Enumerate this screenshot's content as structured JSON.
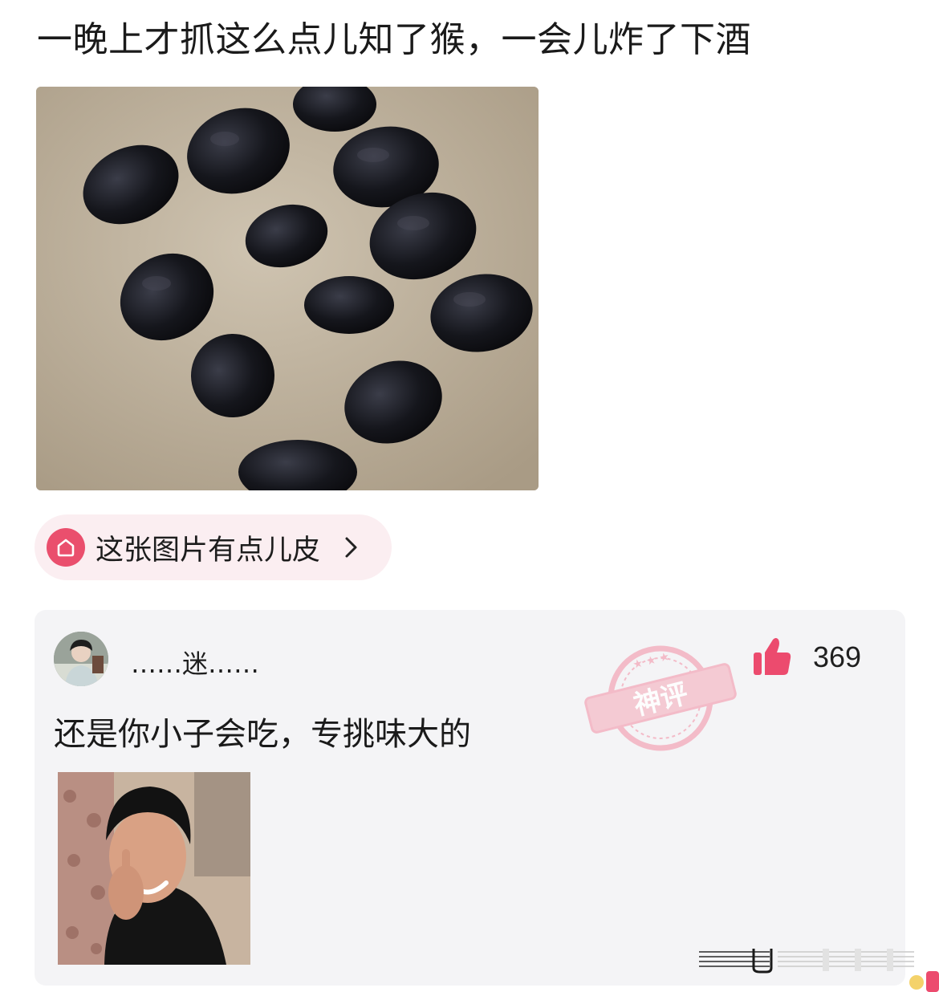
{
  "post": {
    "title": "一晚上才抓这么点儿知了猴，一会儿炸了下酒"
  },
  "topic": {
    "label": "这张图片有点儿皮",
    "icon": "topic-home-icon",
    "chevron": "chevron-right-icon",
    "accent": "#ea4f6d",
    "background": "#fbeef1"
  },
  "comment": {
    "username": "……迷……",
    "text": "还是你小子会吃，专挑味大的",
    "likes": "369",
    "like_icon": "thumbs-up-icon",
    "like_color": "#ec4b6e",
    "stamp_text": "神评",
    "stamp_color": "#f3b2c0",
    "card_background": "#f4f4f6"
  }
}
